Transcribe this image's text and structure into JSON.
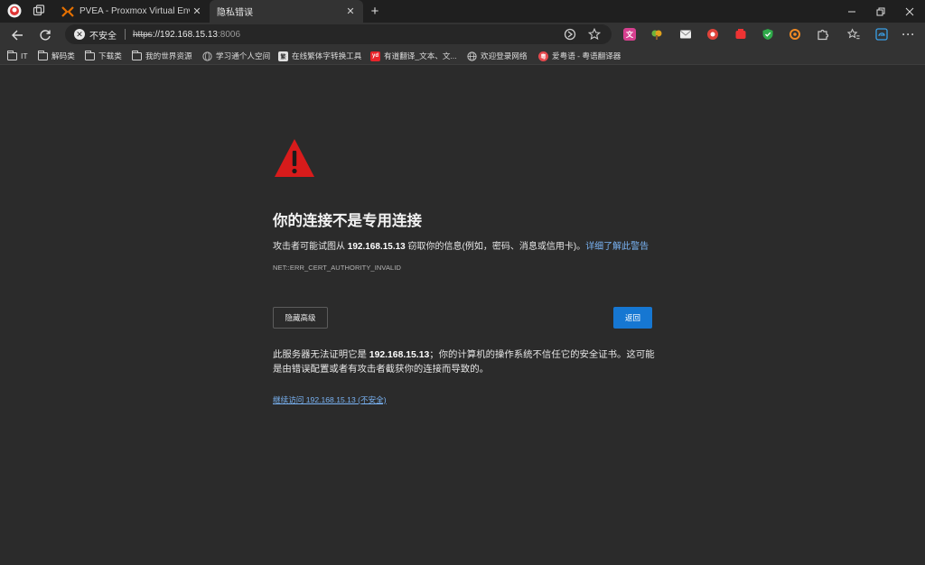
{
  "tabs": [
    {
      "title": "PVEA - Proxmox Virtual Environment",
      "active": false
    },
    {
      "title": "隐私错误",
      "active": true
    }
  ],
  "toolbar": {
    "security_label": "不安全",
    "url_scheme": "https",
    "url_host": "://192.168.15.13",
    "url_port": ":8006"
  },
  "bookmarks": [
    {
      "label": "IT",
      "icon": "folder-icon"
    },
    {
      "label": "解码类",
      "icon": "folder-icon"
    },
    {
      "label": "下载类",
      "icon": "folder-icon"
    },
    {
      "label": "我的世界资源",
      "icon": "folder-icon"
    },
    {
      "label": "学习通个人空间",
      "icon": "globe-icon"
    },
    {
      "label": "在线繁体字转换工具",
      "icon": "site-icon"
    },
    {
      "label": "有道翻译_文本、文...",
      "icon": "youdao-icon"
    },
    {
      "label": "欢迎登录网络",
      "icon": "globe-icon"
    },
    {
      "label": "爱粤语 - 粤语翻译器",
      "icon": "site-icon"
    }
  ],
  "content": {
    "heading": "你的连接不是专用连接",
    "desc_prefix": "攻击者可能试图从 ",
    "host": "192.168.15.13",
    "desc_suffix": " 窃取你的信息(例如，密码、消息或信用卡)。",
    "learn_more": "详细了解此警告",
    "error_code": "NET::ERR_CERT_AUTHORITY_INVALID",
    "hide_advanced": "隐藏高级",
    "back": "返回",
    "detail_prefix": "此服务器无法证明它是 ",
    "detail_suffix": "；你的计算机的操作系统不信任它的安全证书。这可能是由错误配置或者有攻击者截获你的连接而导致的。",
    "proceed_link": "继续访问 192.168.15.13 (不安全)"
  },
  "colors": {
    "page_bg": "#2b2b2b",
    "accent": "#1677d2",
    "link": "#7ab4f5",
    "warning": "#d81b1b"
  }
}
